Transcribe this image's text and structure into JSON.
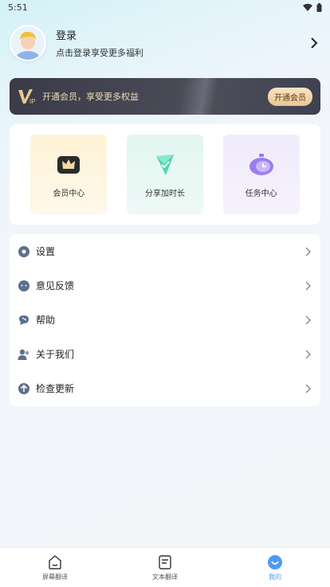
{
  "status_bar": {
    "time": "5:51"
  },
  "profile": {
    "title": "登录",
    "subtitle": "点击登录享受更多福利"
  },
  "vip": {
    "logo_text": "VIP",
    "text": "开通会员，享受更多权益",
    "button": "开通会员"
  },
  "features": [
    {
      "label": "会员中心",
      "icon": "crown-icon"
    },
    {
      "label": "分享加时长",
      "icon": "share-icon"
    },
    {
      "label": "任务中心",
      "icon": "clock-icon"
    }
  ],
  "menu": [
    {
      "label": "设置",
      "icon": "settings-icon"
    },
    {
      "label": "意见反馈",
      "icon": "feedback-icon"
    },
    {
      "label": "帮助",
      "icon": "help-icon"
    },
    {
      "label": "关于我们",
      "icon": "about-icon"
    },
    {
      "label": "检查更新",
      "icon": "update-icon"
    }
  ],
  "bottom_nav": [
    {
      "label": "屏幕翻译",
      "icon": "screen-translate-icon",
      "active": false
    },
    {
      "label": "文本翻译",
      "icon": "text-translate-icon",
      "active": false
    },
    {
      "label": "我的",
      "icon": "profile-icon",
      "active": true
    }
  ],
  "colors": {
    "accent": "#4e9af3",
    "vip_gold": "#f0dcb6",
    "vip_dark": "#3f4050"
  }
}
